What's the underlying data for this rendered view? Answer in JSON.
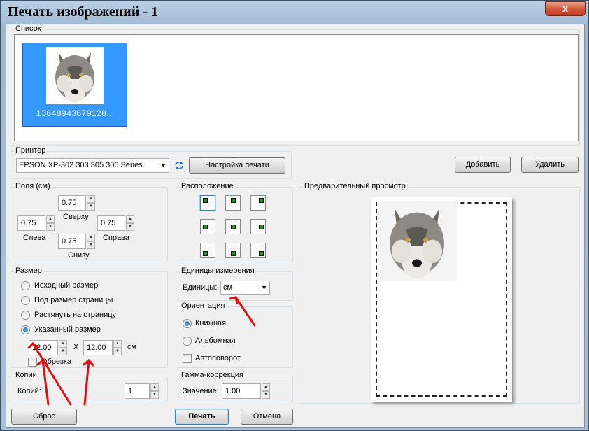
{
  "window": {
    "title": "Печать изображений - 1",
    "close_glyph": "x"
  },
  "list": {
    "group_label": "Список",
    "items": [
      {
        "caption": "13648943679128..."
      }
    ]
  },
  "printer": {
    "group_label": "Принтер",
    "selected": "EPSON XP-302 303 305 306 Series",
    "setup_button": "Настройка печати"
  },
  "add_button": "Добавить",
  "delete_button": "Удалить",
  "margins": {
    "group_label": "Поля (см)",
    "top": {
      "value": "0.75",
      "label": "Сверху"
    },
    "left": {
      "value": "0.75",
      "label": "Слева"
    },
    "right": {
      "value": "0.75",
      "label": "Справа"
    },
    "bottom": {
      "value": "0.75",
      "label": "Снизу"
    }
  },
  "layout": {
    "group_label": "Расположение"
  },
  "preview": {
    "group_label": "Предварительный просмотр"
  },
  "size": {
    "group_label": "Размер",
    "options": [
      "Исходный размер",
      "Под размер страницы",
      "Растянуть на страницу",
      "Указанный размер"
    ],
    "selected_index": 3,
    "width": "12.00",
    "sep": "X",
    "height": "12.00",
    "unit": "см",
    "crop_label": "Обрезка"
  },
  "units": {
    "group_label": "Единицы измерения",
    "label": "Единицы:",
    "selected": "см"
  },
  "orientation": {
    "group_label": "Ориентация",
    "portrait": "Книжная",
    "landscape": "Альбомная",
    "autorotate": "Автоповорот"
  },
  "copies": {
    "group_label": "Копии",
    "label": "Копий:",
    "value": "1"
  },
  "gamma": {
    "group_label": "Гамма-коррекция",
    "label": "Значение:",
    "value": "1.00"
  },
  "buttons": {
    "reset": "Сброс",
    "print": "Печать",
    "cancel": "Отмена"
  },
  "colors": {
    "selection": "#3399ff",
    "annotation_arrows": "#e01010",
    "checkmark": "#1a8f1a"
  }
}
